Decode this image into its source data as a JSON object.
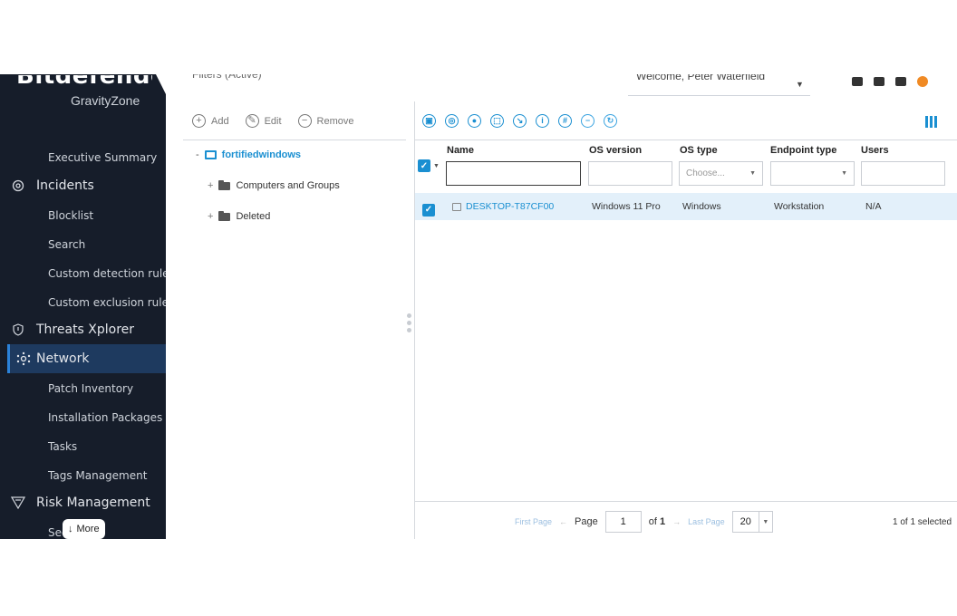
{
  "brand": {
    "wordmark": "Bitdefender",
    "product": "GravityZone"
  },
  "header": {
    "filters": "Filters (Active)",
    "welcome": "Welcome, Peter Waterfield"
  },
  "sidebar": {
    "items": [
      {
        "label": "Executive Summary",
        "type": "sub"
      },
      {
        "label": "Incidents",
        "type": "main",
        "icon": "incidents-icon"
      },
      {
        "label": "Blocklist",
        "type": "sub"
      },
      {
        "label": "Search",
        "type": "sub"
      },
      {
        "label": "Custom detection rules",
        "type": "sub"
      },
      {
        "label": "Custom exclusion rules",
        "type": "sub"
      },
      {
        "label": "Threats Xplorer",
        "type": "main",
        "icon": "shield-icon"
      },
      {
        "label": "Network",
        "type": "main",
        "icon": "network-icon",
        "active": true
      },
      {
        "label": "Patch Inventory",
        "type": "sub"
      },
      {
        "label": "Installation Packages",
        "type": "sub"
      },
      {
        "label": "Tasks",
        "type": "sub"
      },
      {
        "label": "Tags Management",
        "type": "sub"
      },
      {
        "label": "Risk Management",
        "type": "main",
        "icon": "risk-icon"
      }
    ],
    "more_label": "More",
    "partial_item": "Sec"
  },
  "tree": {
    "toolbar": {
      "add": "Add",
      "edit": "Edit",
      "remove": "Remove"
    },
    "root": "fortifiedwindows",
    "children": [
      "Computers and Groups",
      "Deleted"
    ]
  },
  "grid": {
    "actions": [
      "scan-icon",
      "patch-icon",
      "policy-icon",
      "assign-icon",
      "select-icon",
      "info-icon",
      "tag-icon",
      "remove-icon",
      "refresh-icon"
    ],
    "columns": {
      "name": "Name",
      "os_version": "OS version",
      "os_type": "OS type",
      "endpoint_type": "Endpoint type",
      "users": "Users"
    },
    "filters": {
      "os_type_placeholder": "Choose..."
    },
    "rows": [
      {
        "name": "DESKTOP-T87CF00",
        "os_version": "Windows 11 Pro",
        "os_type": "Windows",
        "endpoint_type": "Workstation",
        "users": "N/A",
        "checked": true
      }
    ],
    "pagination": {
      "first": "First Page",
      "page_label": "Page",
      "page_value": "1",
      "of_label": "of",
      "total_pages": "1",
      "last": "Last Page",
      "page_size": "20",
      "selected": "1 of 1 selected"
    }
  },
  "colors": {
    "sidebar_bg": "#161d2a",
    "accent": "#1a8fd1",
    "row_selected": "#e3f0fa",
    "notification": "#f08a24"
  }
}
